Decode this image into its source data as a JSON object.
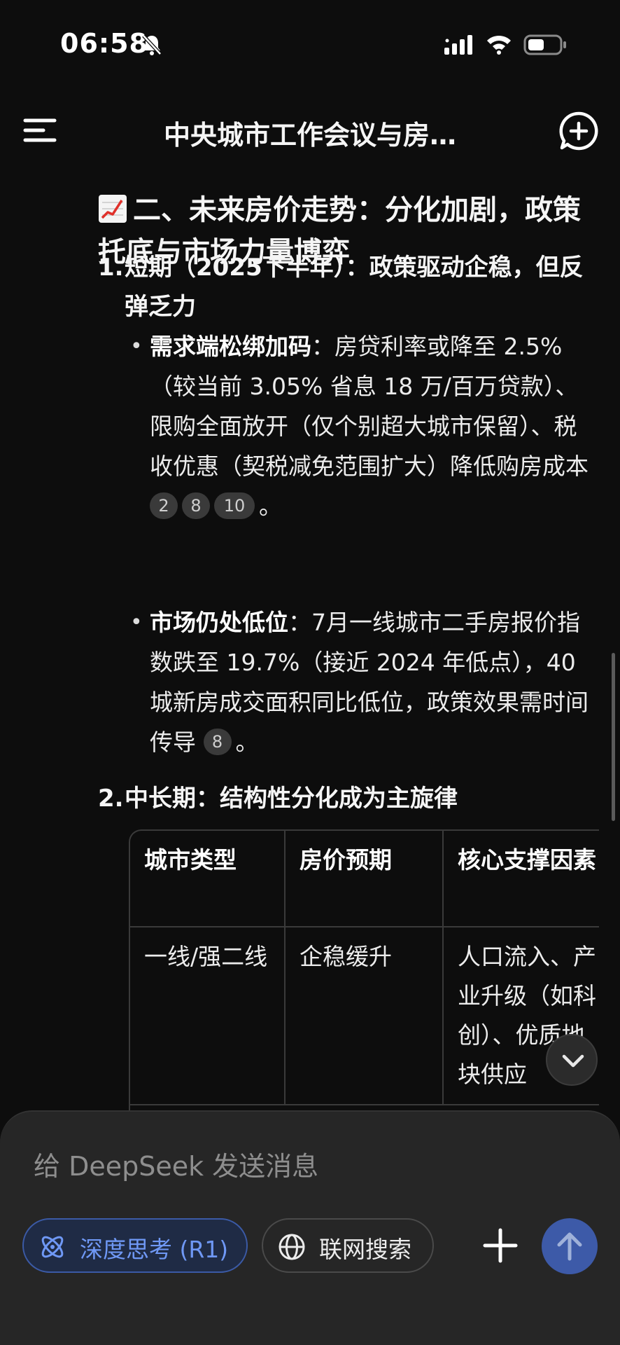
{
  "status_bar": {
    "time": "06:58"
  },
  "header": {
    "title": "中央城市工作会议与房…"
  },
  "content": {
    "section_heading": "二、未来房价走势：分化加剧，政策托底与市场力量博弈",
    "items": [
      {
        "number": "1.",
        "title": "短期（2025下半年）：政策驱动企稳，但反弹乏力",
        "bullets": [
          {
            "bold": "需求端松绑加码",
            "text": "：房贷利率或降至 2.5%（较当前 3.05% 省息 18 万/百万贷款）、限购全面放开（仅个别超大城市保留）、税收优惠（契税减免范围扩大）降低购房成本",
            "citations": [
              "2",
              "8",
              "10"
            ],
            "end": "。"
          },
          {
            "bold": "市场仍处低位",
            "text": "：7月一线城市二手房报价指数跌至 19.7%（接近 2024 年低点），40 城新房成交面积同比低位，政策效果需时间传导",
            "citations": [
              "8"
            ],
            "end": "。"
          }
        ]
      },
      {
        "number": "2.",
        "title": "中长期：结构性分化成为主旋律"
      }
    ],
    "table": {
      "headers": [
        "城市类型",
        "房价预期",
        "核心支撑因素"
      ],
      "rows": [
        [
          "一线/强二线",
          "企稳缓升",
          "人口流入、产业升级（如科创）、优质地块供应"
        ]
      ]
    }
  },
  "input": {
    "placeholder": "给 DeepSeek 发送消息",
    "deep_think_label": "深度思考 (R1)",
    "web_search_label": "联网搜索"
  },
  "colors": {
    "background": "#0d0d0d",
    "panel": "#262626",
    "accent": "#3d5aa8",
    "accent_text": "#6f98f5"
  },
  "icons": {
    "menu": "menu-icon",
    "new_chat": "new-chat-icon",
    "scroll_down": "chevron-down-icon",
    "deep_think": "atom-icon",
    "web_search": "globe-icon",
    "attach": "plus-icon",
    "send": "arrow-up-icon"
  }
}
